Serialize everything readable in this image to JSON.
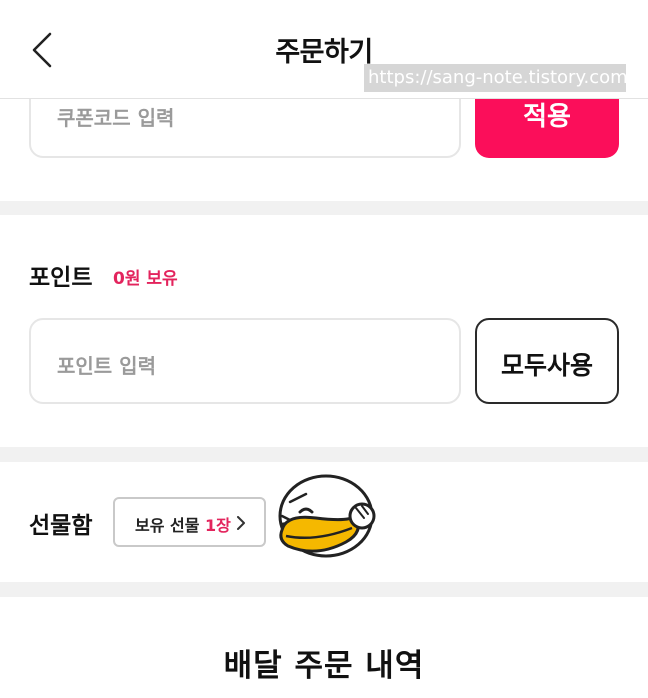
{
  "header": {
    "title": "주문하기",
    "watermark": "https://sang-note.tistory.com"
  },
  "coupon": {
    "placeholder": "쿠폰코드 입력",
    "apply_label": "적용"
  },
  "points": {
    "title": "포인트",
    "owned": "0원 보유",
    "placeholder": "포인트 입력",
    "use_all_label": "모두사용"
  },
  "giftbox": {
    "title": "선물함",
    "owned_prefix": "보유 선물",
    "owned_count": "1장"
  },
  "delivery": {
    "title": "배달 주문 내역"
  },
  "colors": {
    "accent": "#fb0e5a",
    "accent_text": "#e3245d",
    "section_gap": "#f1f1f1",
    "mascot_yellow": "#f5b800"
  },
  "icons": {
    "back": "chevron-left-icon",
    "giftbox_arrow": "chevron-right-icon",
    "mascot": "duck-mascot-icon"
  }
}
